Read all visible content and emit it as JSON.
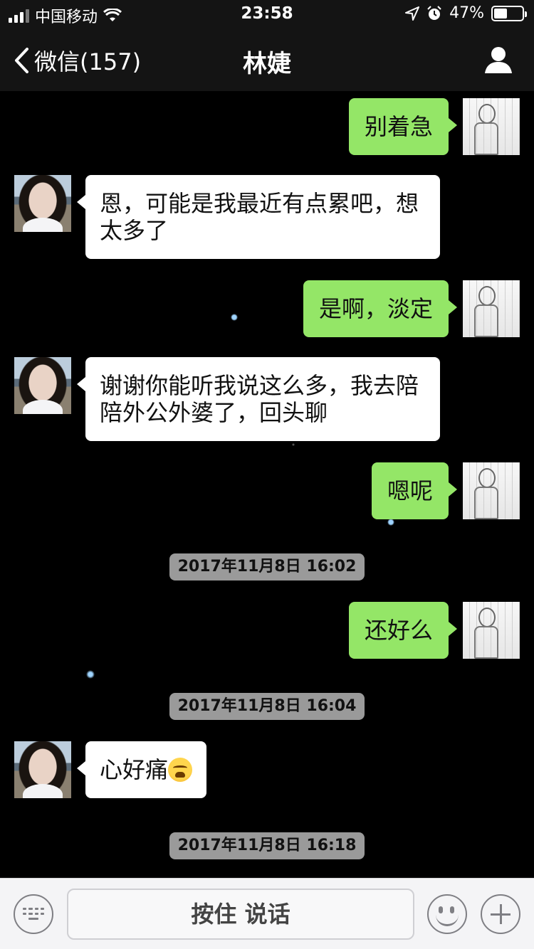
{
  "status_bar": {
    "carrier": "中国移动",
    "time": "23:58",
    "battery_percent": "47%",
    "battery_level": 0.47,
    "icons": [
      "signal-icon",
      "wifi-icon",
      "location-icon",
      "alarm-icon",
      "battery-icon"
    ]
  },
  "nav": {
    "back_label": "微信(157)",
    "title": "林婕",
    "right_icon": "user-icon"
  },
  "messages": [
    {
      "side": "right",
      "text": "别着急"
    },
    {
      "side": "left",
      "text": "恩，可能是我最近有点累吧，想\n太多了"
    },
    {
      "side": "right",
      "text": "是啊，淡定"
    },
    {
      "side": "left",
      "text": "谢谢你能听我说这么多，我去陪\n陪外公外婆了，回头聊"
    },
    {
      "side": "right",
      "text": "嗯呢"
    },
    {
      "type": "timestamp",
      "text": "2017年11月8日 16:02"
    },
    {
      "side": "right",
      "text": "还好么"
    },
    {
      "type": "timestamp",
      "text": "2017年11月8日 16:04"
    },
    {
      "side": "left",
      "text": "心好痛",
      "emoji": "crying-face-icon"
    },
    {
      "type": "timestamp",
      "text": "2017年11月8日 16:18"
    }
  ],
  "input_bar": {
    "hold_to_talk_label": "按住 说话",
    "left_icon": "keyboard-icon",
    "emoji_icon": "smiley-icon",
    "more_icon": "plus-icon"
  },
  "colors": {
    "background": "#000000",
    "bar": "#141414",
    "outgoing_bubble": "#94e667",
    "incoming_bubble": "#ffffff",
    "timestamp_bg": "#9a9a9a",
    "toolbar": "#f4f4f6"
  }
}
